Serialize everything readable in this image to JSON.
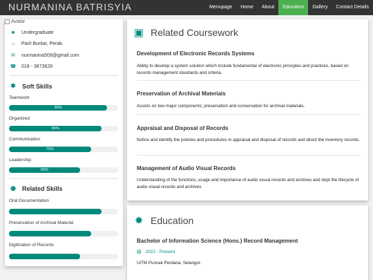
{
  "brand": "NURMANINA BATRISYIA",
  "nav": [
    {
      "label": "Menupage",
      "active": false
    },
    {
      "label": "Home",
      "active": false
    },
    {
      "label": "About",
      "active": false
    },
    {
      "label": "Education",
      "active": true
    },
    {
      "label": "Gallery",
      "active": false
    },
    {
      "label": "Contact Details",
      "active": false
    }
  ],
  "profile": {
    "avatar_alt": "Avatar",
    "status": "Undergraduate",
    "location": "Parit Buntar, Perak.",
    "email": "nurmanina509@gmail.com",
    "phone": "018 - 3873628",
    "icons": {
      "status": "briefcase-icon",
      "location": "home-icon",
      "email": "envelope-icon",
      "phone": "phone-icon"
    }
  },
  "soft_skills": {
    "title": "Soft Skills",
    "icon": "asterisk-icon",
    "items": [
      {
        "label": "Teamwork",
        "percent": 90,
        "percent_label": "90%"
      },
      {
        "label": "Organized",
        "percent": 85,
        "percent_label": "85%"
      },
      {
        "label": "Communication",
        "percent": 75,
        "percent_label": "75%"
      },
      {
        "label": "Leadership",
        "percent": 65,
        "percent_label": "65%"
      }
    ]
  },
  "related_skills": {
    "title": "Related Skills",
    "icon": "globe-icon",
    "items": [
      {
        "label": "Oral Documentation",
        "percent": 85
      },
      {
        "label": "Preservation of Archival Material",
        "percent": 75
      },
      {
        "label": "Digitization of Records",
        "percent": 65
      }
    ]
  },
  "coursework": {
    "title": "Related Coursework",
    "icon": "suitcase-icon",
    "entries": [
      {
        "title": "Development of Electronic Records Systems",
        "desc": "Ability to develop a system solution which include fundamental of electronic principles and practices, based on records management standards and criteria."
      },
      {
        "title": "Preservation of Archival Materials",
        "desc": "Assists on two major components; preservation and conservation for archival materials."
      },
      {
        "title": "Appraisal and Disposal of Records",
        "desc": "Notice and identify the policies and procedures in appraisal and disposal of records and direct the inventory records."
      },
      {
        "title": "Management of Audio Visual Records",
        "desc": "Understanding of the functions, usage and importance of audio visual records and archives and dopt the lifecycle of audio visual records and archives"
      }
    ]
  },
  "education": {
    "title": "Education",
    "icon": "certificate-icon",
    "entries": [
      {
        "title": "Bachelor of Information Science (Hons.) Record Management",
        "date": "2022 - Present",
        "place": "UiTM Puncak Perdana, Selangor."
      }
    ]
  },
  "colors": {
    "accent": "#00897b",
    "nav_bg": "#333333",
    "nav_active": "#4caf50"
  }
}
